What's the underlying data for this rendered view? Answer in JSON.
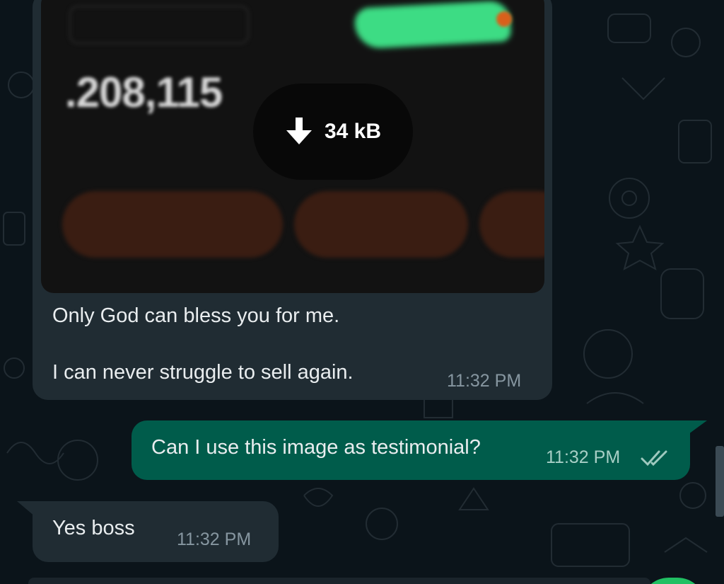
{
  "theme": {
    "background": "#0b141a",
    "incoming_bubble": "#202c33",
    "outgoing_bubble": "#005c4b",
    "text": "#e9edef",
    "meta": "#8696a0",
    "accent": "#21c063"
  },
  "image_message": {
    "attachment": {
      "blurred_balance": ".208,115",
      "download_icon": "download-arrow-icon",
      "download_size": "34 kB"
    },
    "text_line_1": "Only God can bless you for me.",
    "text_line_2": "I can never struggle to sell again.",
    "time": "11:32 PM"
  },
  "outgoing_message": {
    "text": "Can I use this image as testimonial?",
    "time": "11:32 PM",
    "status_icon": "double-check-read-icon"
  },
  "reply_message": {
    "text": "Yes boss",
    "time": "11:32 PM"
  }
}
